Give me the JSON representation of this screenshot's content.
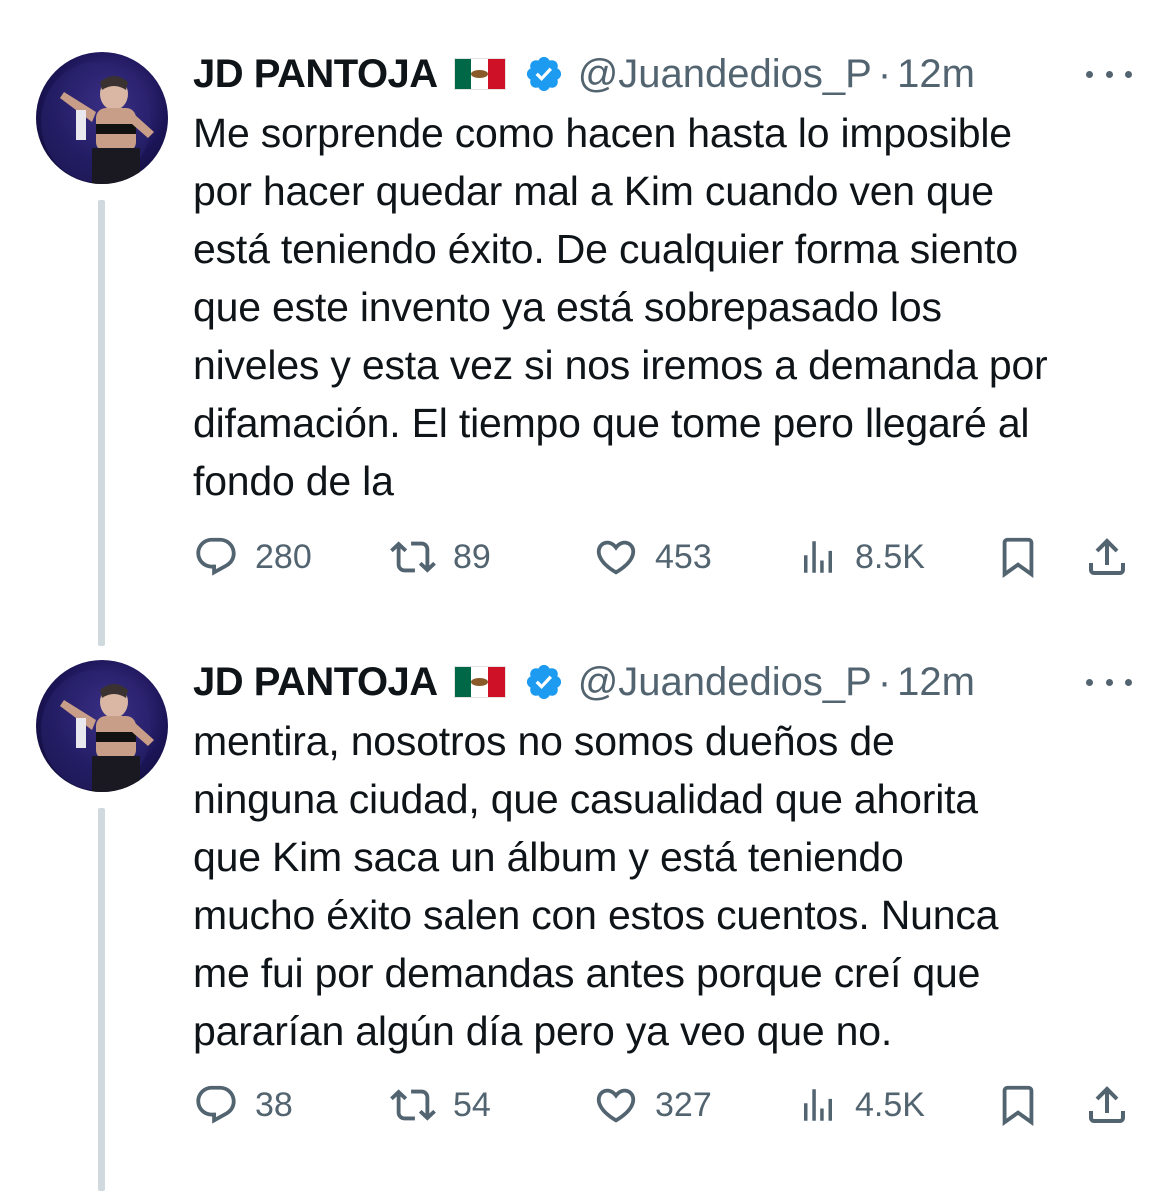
{
  "tweets": [
    {
      "display_name": "JD PANTOJA",
      "flag": "mexico-flag",
      "verified": true,
      "handle": "@Juandedios_P",
      "separator": "·",
      "time": "12m",
      "text": "Me sorprende como hacen hasta lo imposible\npor hacer quedar mal a Kim cuando ven que\nestá teniendo éxito. De cualquier forma siento\nque este invento ya está sobrepasado los\nniveles y esta vez si nos iremos a demanda por\ndifamación. El tiempo que tome pero llegaré al\nfondo de la",
      "replies": "280",
      "retweets": "89",
      "likes": "453",
      "views": "8.5K"
    },
    {
      "display_name": "JD PANTOJA",
      "flag": "mexico-flag",
      "verified": true,
      "handle": "@Juandedios_P",
      "separator": "·",
      "time": "12m",
      "text": "mentira, nosotros no somos dueños de\nninguna ciudad, que casualidad que ahorita\nque Kim saca un álbum y está teniendo\nmucho éxito salen con estos cuentos. Nunca\nme fui por demandas antes porque creí que\npararían algún día pero ya veo que no.",
      "replies": "38",
      "retweets": "54",
      "likes": "327",
      "views": "4.5K"
    }
  ],
  "colors": {
    "text": "#0f1419",
    "secondary": "#536471",
    "verified_blue": "#1d9bf0",
    "thread_line": "#cfd9de"
  },
  "icons": [
    "reply-icon",
    "retweet-icon",
    "like-icon",
    "views-icon",
    "bookmark-icon",
    "share-icon",
    "more-icon",
    "verified-icon"
  ]
}
